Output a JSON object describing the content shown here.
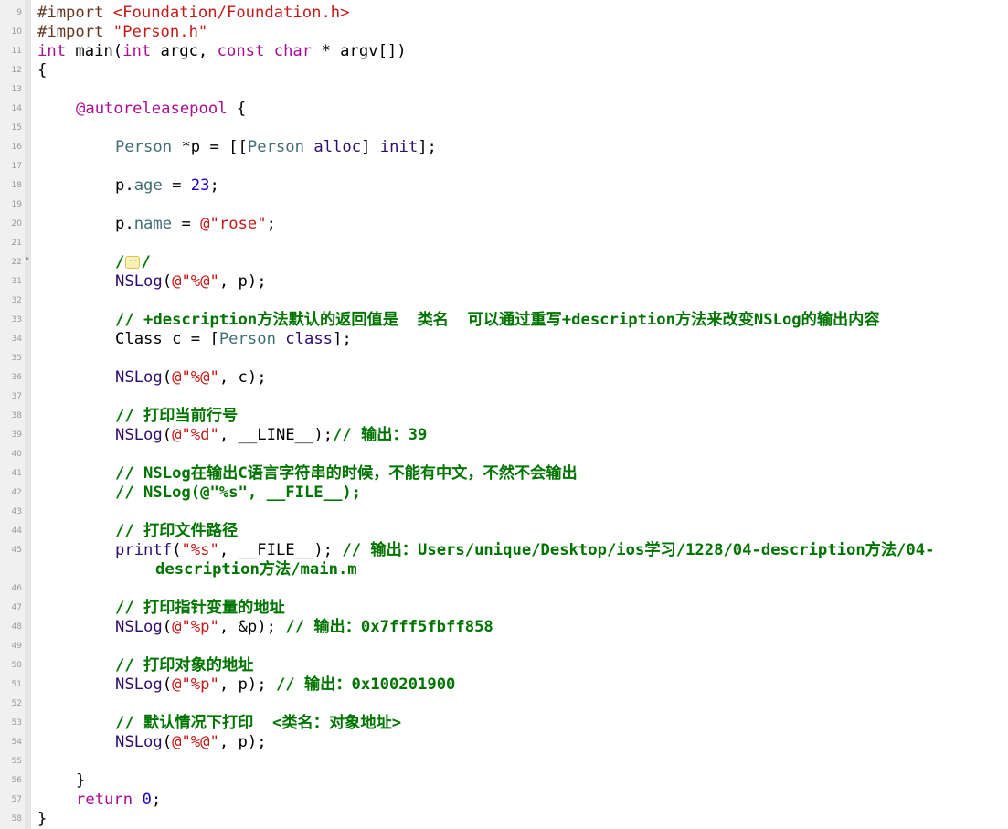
{
  "editor": {
    "line_numbers": [
      "9",
      "10",
      "11",
      "12",
      "13",
      "14",
      "15",
      "16",
      "17",
      "18",
      "19",
      "20",
      "21",
      "22",
      "31",
      "32",
      "33",
      "34",
      "35",
      "36",
      "37",
      "38",
      "39",
      "40",
      "41",
      "42",
      "43",
      "44",
      "45",
      "46",
      "47",
      "48",
      "49",
      "50",
      "51",
      "52",
      "53",
      "54",
      "55",
      "56",
      "57",
      "58"
    ],
    "code": {
      "import_kw_1": "#import",
      "import_path_1": "<Foundation/Foundation.h>",
      "import_kw_2": "#import",
      "import_path_2": "\"Person.h\"",
      "int_kw": "int",
      "main_sig_a": " main(",
      "int_kw_2": "int",
      "main_sig_b": " argc, ",
      "const_kw": "const",
      "space1": " ",
      "char_kw": "char",
      "main_sig_c": " * argv[])",
      "open_brace": "{",
      "autorelease": "@autoreleasepool",
      "autorelease_brace": " {",
      "person_cls": "Person",
      "person_decl_a": " *p = [[",
      "person_cls_2": "Person",
      "space2": " ",
      "alloc": "alloc",
      "person_decl_b": "] ",
      "init": "init",
      "person_decl_c": "];",
      "p_dot": "p.",
      "age": "age",
      "eq": " = ",
      "age_val": "23",
      "semi": ";",
      "p_dot_2": "p.",
      "name": "name",
      "eq_2": " = ",
      "name_val": "@\"rose\"",
      "semi_2": ";",
      "fold_slash_a": "/",
      "fold_dots": "···",
      "fold_slash_b": "/",
      "nslog": "NSLog",
      "nslog_paren": "(",
      "fmt_obj": "@\"%@\"",
      "nslog_p_end": ", p);",
      "comment_desc": "// +description方法默认的返回值是  类名  可以通过重写+description方法来改变NSLog的输出内容",
      "class_kw": "Class c = [",
      "person_cls_3": "Person",
      "space3": " ",
      "class_msg": "class",
      "class_end": "];",
      "nslog_2": "NSLog",
      "paren_2": "(",
      "fmt_obj_2": "@\"%@\"",
      "nslog_c_end": ", c);",
      "comment_line": "// 打印当前行号",
      "nslog_3": "NSLog",
      "paren_3": "(",
      "fmt_d": "@\"%d\"",
      "line_arg": ", __LINE__);",
      "comment_line_out": "// 输出：39",
      "comment_nslog_c": "// NSLog在输出C语言字符串的时候，不能有中文，不然不会输出",
      "comment_nslog_file": "// NSLog(@\"%s\", __FILE__);",
      "comment_filepath": "// 打印文件路径",
      "printf": "printf",
      "printf_paren": "(",
      "fmt_s": "\"%s\"",
      "file_arg": ", __FILE__); ",
      "comment_file_out": "// 输出：Users/unique/Desktop/ios学习/1228/04-description方法/04-",
      "comment_file_out_2": "description方法/main.m",
      "comment_ptr_var": "// 打印指针变量的地址",
      "nslog_4": "NSLog",
      "paren_4": "(",
      "fmt_p": "@\"%p\"",
      "amp_p": ", &p); ",
      "comment_ptr_out": "// 输出：0x7fff5fbff858",
      "comment_obj_addr": "// 打印对象的地址",
      "nslog_5": "NSLog",
      "paren_5": "(",
      "fmt_p_2": "@\"%p\"",
      "p_arg": ", p); ",
      "comment_obj_out": "// 输出：0x100201900",
      "comment_default": "// 默认情况下打印  <类名：对象地址>",
      "nslog_6": "NSLog",
      "paren_6": "(",
      "fmt_obj_3": "@\"%@\"",
      "nslog_p_end_2": ", p);",
      "close_pool": "}",
      "return_kw": "return",
      "space4": " ",
      "ret_val": "0",
      "ret_semi": ";",
      "close_main": "}"
    }
  },
  "colors": {
    "preprocessor": "#643820",
    "string": "#c41a16",
    "keyword": "#aa0d91",
    "class": "#3f6e74",
    "method": "#2e0d6e",
    "number": "#1c00cf",
    "comment": "#007400"
  },
  "icons": {
    "fold_marker": "fold-collapsed-icon"
  }
}
